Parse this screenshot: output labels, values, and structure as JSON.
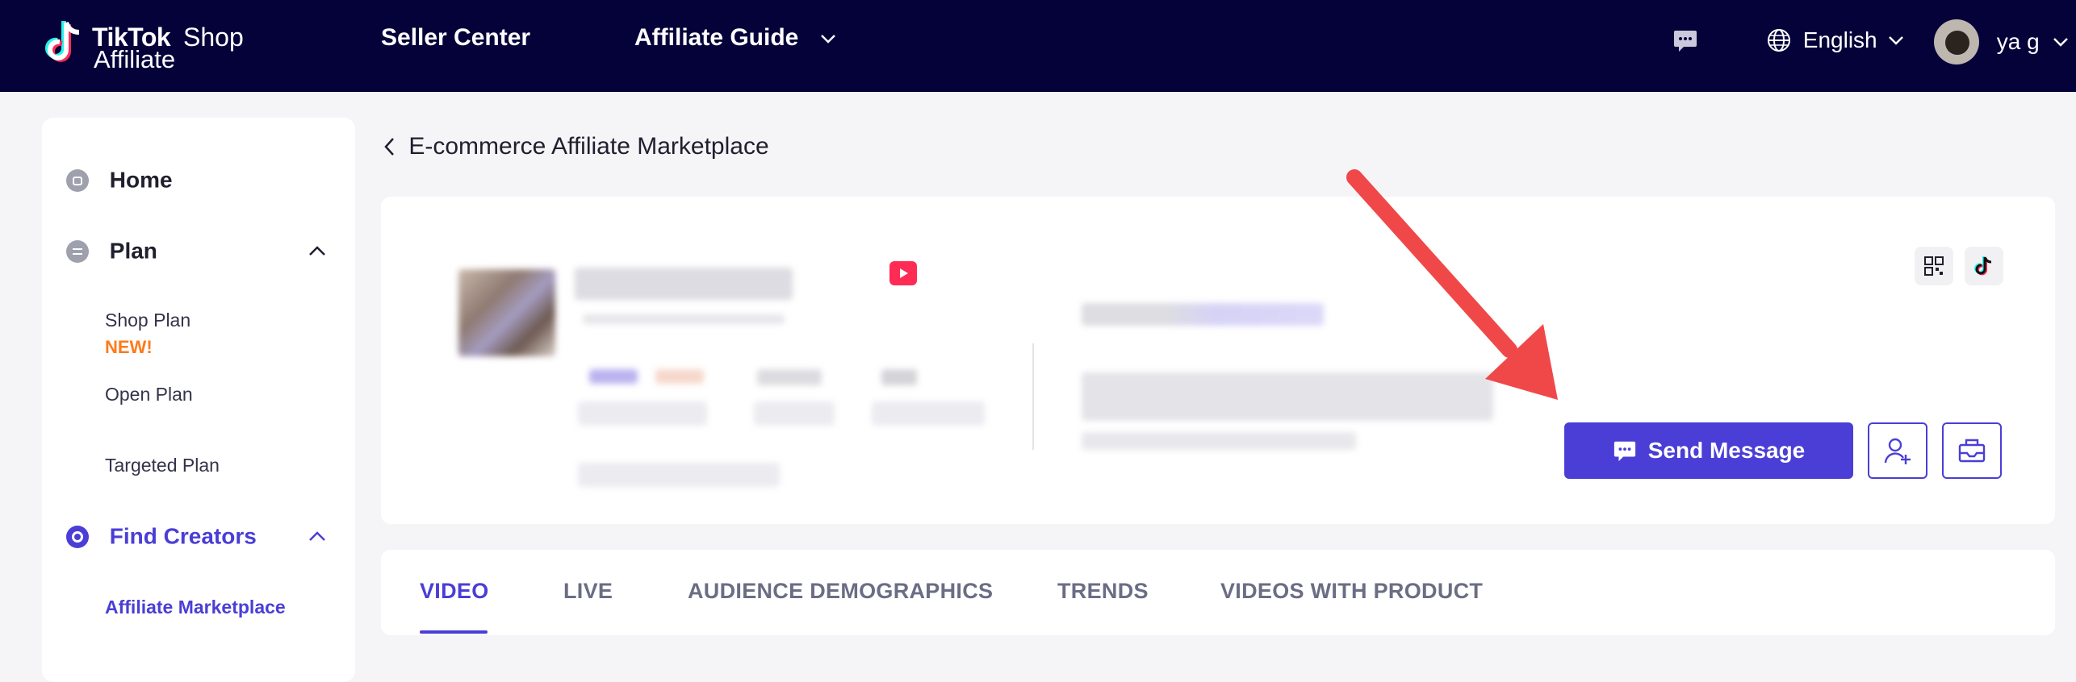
{
  "topbar": {
    "logo_tiktok": "TikTok",
    "logo_shop": "Shop",
    "logo_affiliate": "Affiliate",
    "nav_seller_center": "Seller Center",
    "nav_affiliate_guide": "Affiliate Guide",
    "language": "English",
    "user_name": "ya g"
  },
  "sidebar": {
    "home": "Home",
    "plan": "Plan",
    "plan_items": [
      {
        "label": "Shop Plan",
        "badge": "NEW!"
      },
      {
        "label": "Open Plan"
      },
      {
        "label": "Targeted Plan"
      }
    ],
    "find_creators": "Find Creators",
    "find_items": [
      {
        "label": "Affiliate Marketplace"
      }
    ]
  },
  "breadcrumb": "E-commerce Affiliate Marketplace",
  "profile": {
    "send_message": "Send Message"
  },
  "tabs": [
    {
      "label": "VIDEO",
      "active": true
    },
    {
      "label": "LIVE"
    },
    {
      "label": "AUDIENCE DEMOGRAPHICS"
    },
    {
      "label": "TRENDS"
    },
    {
      "label": "VIDEOS WITH PRODUCT"
    }
  ],
  "colors": {
    "topbar": "#05023a",
    "accent": "#4a3ed6",
    "new_badge": "#ff7a1a",
    "live_icon": "#fe2c55",
    "arrow": "#f04848"
  }
}
